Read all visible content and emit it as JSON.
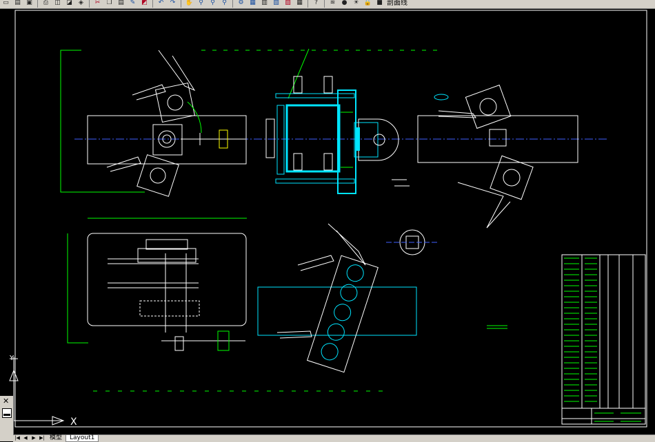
{
  "toolbar": {
    "buttons": [
      {
        "name": "new-icon",
        "glyph": "▭"
      },
      {
        "name": "open-icon",
        "glyph": "▤"
      },
      {
        "name": "save-icon",
        "glyph": "▣"
      },
      {
        "sep": true
      },
      {
        "name": "print-icon",
        "glyph": "⎙"
      },
      {
        "name": "plot-preview-icon",
        "glyph": "◫"
      },
      {
        "name": "publish-icon",
        "glyph": "◪"
      },
      {
        "name": "3d-dwf-icon",
        "glyph": "◈"
      },
      {
        "sep": true
      },
      {
        "name": "cut-icon",
        "glyph": "✂"
      },
      {
        "name": "copy-icon",
        "glyph": "❐"
      },
      {
        "name": "paste-icon",
        "glyph": "▤"
      },
      {
        "name": "match-properties-icon",
        "glyph": "✎"
      },
      {
        "name": "block-editor-icon",
        "glyph": "◩"
      },
      {
        "sep": true
      },
      {
        "name": "undo-icon",
        "glyph": "↶"
      },
      {
        "name": "redo-icon",
        "glyph": "↷"
      },
      {
        "sep": true
      },
      {
        "name": "pan-icon",
        "glyph": "✋"
      },
      {
        "name": "zoom-realtime-icon",
        "glyph": "⚲"
      },
      {
        "name": "zoom-window-icon",
        "glyph": "⚲"
      },
      {
        "name": "zoom-previous-icon",
        "glyph": "⚲"
      },
      {
        "sep": true
      },
      {
        "name": "properties-icon",
        "glyph": "⚙"
      },
      {
        "name": "design-center-icon",
        "glyph": "▦"
      },
      {
        "name": "tool-palettes-icon",
        "glyph": "▥"
      },
      {
        "name": "sheet-set-icon",
        "glyph": "▧"
      },
      {
        "name": "markup-icon",
        "glyph": "▨"
      },
      {
        "name": "quickcalc-icon",
        "glyph": "▦"
      },
      {
        "sep": true
      },
      {
        "name": "help-icon",
        "glyph": "?"
      },
      {
        "sep": true
      },
      {
        "name": "layer-manager-icon",
        "glyph": "≋"
      },
      {
        "name": "layer-on-icon",
        "glyph": "●"
      },
      {
        "name": "layer-sun-icon",
        "glyph": "☀"
      },
      {
        "name": "layer-lock-icon",
        "glyph": "🔒"
      },
      {
        "name": "layer-color-icon",
        "glyph": "■"
      }
    ],
    "layer_name": "剖面线"
  },
  "tabs": {
    "nav": [
      "|◀",
      "◀",
      "▶",
      "▶|"
    ],
    "items": [
      {
        "label": "模型",
        "active": false
      },
      {
        "label": "Layout1",
        "active": true
      }
    ]
  },
  "left_panel": {
    "close": "✕"
  },
  "ucs": {
    "x_label": "X",
    "y_label": "Y"
  },
  "colors": {
    "frame": "#ffffff",
    "cyan": "#00e5ff",
    "green": "#00ff00",
    "yellow": "#ffff00",
    "red": "#ff3030",
    "blue": "#4060ff",
    "magenta": "#ff40ff"
  }
}
